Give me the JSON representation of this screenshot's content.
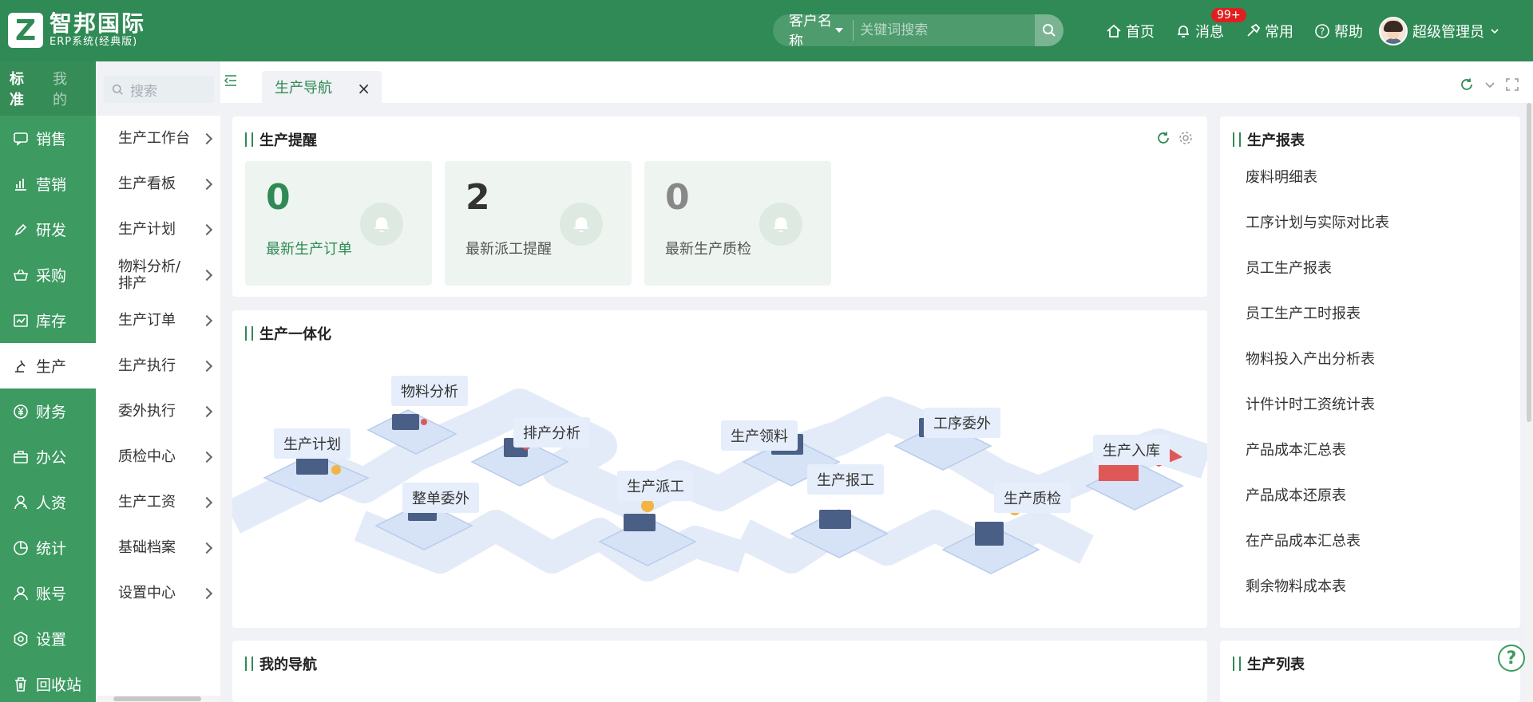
{
  "brand": {
    "mark": "Z",
    "name": "智邦国际",
    "sub": "ERP系统(经典版)"
  },
  "search": {
    "type_label": "客户名称",
    "placeholder": "关键词搜索"
  },
  "top_nav": {
    "home": "首页",
    "messages": "消息",
    "messages_badge": "99+",
    "common": "常用",
    "help": "帮助",
    "user": "超级管理员"
  },
  "sidebar": {
    "tabs": [
      "标准",
      "我的"
    ],
    "search_placeholder": "搜索",
    "items": [
      {
        "label": "销售",
        "icon": "chat-icon"
      },
      {
        "label": "营销",
        "icon": "bar-chart-icon"
      },
      {
        "label": "研发",
        "icon": "pen-icon"
      },
      {
        "label": "采购",
        "icon": "basket-icon"
      },
      {
        "label": "库存",
        "icon": "inventory-icon"
      },
      {
        "label": "生产",
        "icon": "robot-arm-icon",
        "active": true
      },
      {
        "label": "财务",
        "icon": "yen-icon"
      },
      {
        "label": "办公",
        "icon": "briefcase-icon"
      },
      {
        "label": "人资",
        "icon": "person-icon"
      },
      {
        "label": "统计",
        "icon": "pie-icon"
      },
      {
        "label": "账号",
        "icon": "account-icon"
      },
      {
        "label": "设置",
        "icon": "settings-icon"
      },
      {
        "label": "回收站",
        "icon": "trash-icon"
      }
    ]
  },
  "submenu": [
    "生产工作台",
    "生产看板",
    "生产计划",
    "物料分析/排产",
    "生产订单",
    "生产执行",
    "委外执行",
    "质检中心",
    "生产工资",
    "基础档案",
    "设置中心"
  ],
  "tabs": {
    "active": "生产导航"
  },
  "reminder": {
    "title": "生产提醒",
    "cards": [
      {
        "value": "0",
        "label": "最新生产订单",
        "color": "#2f8a55"
      },
      {
        "value": "2",
        "label": "最新派工提醒",
        "color": "#333333"
      },
      {
        "value": "0",
        "label": "最新生产质检",
        "color": "#888888"
      }
    ]
  },
  "integration": {
    "title": "生产一体化",
    "nodes": [
      "生产计划",
      "物料分析",
      "排产分析",
      "整单委外",
      "生产派工",
      "生产领料",
      "生产报工",
      "工序委外",
      "生产质检",
      "生产入库"
    ]
  },
  "mynav": {
    "title": "我的导航"
  },
  "report": {
    "title": "生产报表",
    "items": [
      "废料明细表",
      "工序计划与实际对比表",
      "员工生产报表",
      "员工生产工时报表",
      "物料投入产出分析表",
      "计件计时工资统计表",
      "产品成本汇总表",
      "产品成本还原表",
      "在产品成本汇总表",
      "剩余物料成本表"
    ]
  },
  "prodlist": {
    "title": "生产列表"
  },
  "colors": {
    "brand": "#2f8a55",
    "sidebar": "#3d9a61",
    "badge": "#e02020"
  }
}
